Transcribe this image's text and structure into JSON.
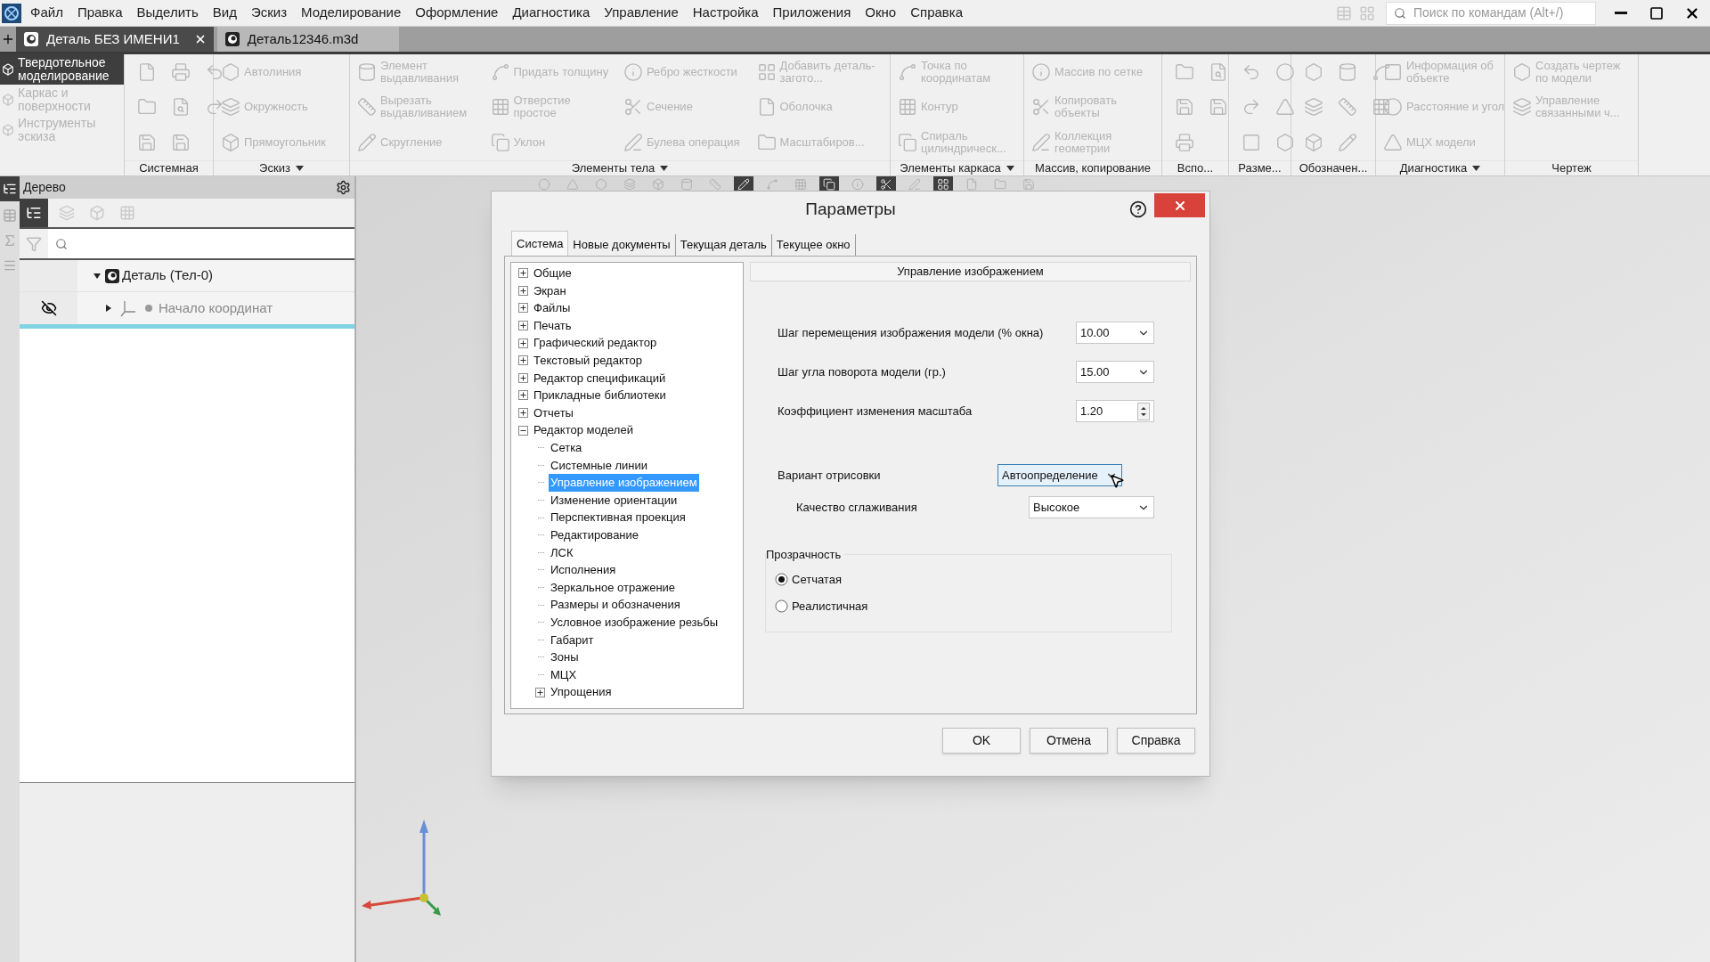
{
  "menu": [
    "Файл",
    "Правка",
    "Выделить",
    "Вид",
    "Эскиз",
    "Моделирование",
    "Оформление",
    "Диагностика",
    "Управление",
    "Настройка",
    "Приложения",
    "Окно",
    "Справка"
  ],
  "command_search": {
    "placeholder": "Поиск по командам (Alt+/)"
  },
  "doc_tabs": [
    {
      "title": "Деталь БЕЗ ИМЕНИ1",
      "selected": true
    },
    {
      "title": "Деталь12346.m3d",
      "selected": false
    }
  ],
  "ribbon": {
    "modes": [
      {
        "label": "Твердотельное моделирование",
        "selected": true
      },
      {
        "label": "Каркас и поверхности",
        "selected": false
      },
      {
        "label": "Инструменты эскиза",
        "selected": false
      }
    ],
    "groups": [
      {
        "label": "Системная",
        "dropdown": false,
        "items": [
          {
            "kind": "icon"
          },
          {
            "kind": "icon"
          },
          {
            "kind": "icon"
          },
          {
            "kind": "icon"
          },
          {
            "kind": "icon"
          },
          {
            "kind": "icon"
          },
          {
            "kind": "icon"
          },
          {
            "kind": "icon"
          }
        ]
      },
      {
        "label": "Эскиз",
        "dropdown": true,
        "items": [
          {
            "kind": "command",
            "label": "Автолиния"
          },
          {
            "kind": "command",
            "label": "Окружность"
          },
          {
            "kind": "command",
            "label": "Прямоугольник"
          }
        ]
      },
      {
        "label": "Элементы тела",
        "dropdown": true,
        "items": [
          {
            "kind": "command",
            "label": "Элемент выдавливания"
          },
          {
            "kind": "command",
            "label": "Вырезать выдавливанием"
          },
          {
            "kind": "command",
            "label": "Скругление"
          },
          {
            "kind": "command",
            "label": "Придать толщину"
          },
          {
            "kind": "command",
            "label": "Отверстие простое"
          },
          {
            "kind": "command",
            "label": "Уклон"
          },
          {
            "kind": "command",
            "label": "Ребро жесткости"
          },
          {
            "kind": "command",
            "label": "Сечение"
          },
          {
            "kind": "command",
            "label": "Булева операция"
          },
          {
            "kind": "command",
            "label": "Добавить деталь-загото..."
          },
          {
            "kind": "command",
            "label": "Оболочка"
          },
          {
            "kind": "command",
            "label": "Масштабиров..."
          }
        ]
      },
      {
        "label": "Элементы каркаса",
        "dropdown": true,
        "items": [
          {
            "kind": "command",
            "label": "Точка по координатам"
          },
          {
            "kind": "command",
            "label": "Контур"
          },
          {
            "kind": "command",
            "label": "Спираль цилиндрическ..."
          }
        ]
      },
      {
        "label": "Массив, копирование",
        "dropdown": false,
        "items": [
          {
            "kind": "command",
            "label": "Массив по сетке"
          },
          {
            "kind": "command",
            "label": "Копировать объекты"
          },
          {
            "kind": "command",
            "label": "Коллекция геометрии"
          }
        ]
      },
      {
        "label": "Вспо...",
        "dropdown": false,
        "items": [
          {
            "kind": "icon"
          },
          {
            "kind": "icon"
          },
          {
            "kind": "icon"
          },
          {
            "kind": "icon"
          },
          {
            "kind": "icon"
          }
        ]
      },
      {
        "label": "Разме...",
        "dropdown": false,
        "items": [
          {
            "kind": "icon"
          },
          {
            "kind": "icon"
          },
          {
            "kind": "icon"
          },
          {
            "kind": "icon"
          },
          {
            "kind": "icon"
          },
          {
            "kind": "icon"
          }
        ]
      },
      {
        "label": "Обозначен...",
        "dropdown": false,
        "items": [
          {
            "kind": "icon"
          },
          {
            "kind": "icon"
          },
          {
            "kind": "icon"
          },
          {
            "kind": "icon"
          },
          {
            "kind": "icon"
          },
          {
            "kind": "icon"
          },
          {
            "kind": "icon"
          },
          {
            "kind": "icon"
          }
        ]
      },
      {
        "label": "Диагностика",
        "dropdown": true,
        "items": [
          {
            "kind": "command",
            "label": "Информация об объекте"
          },
          {
            "kind": "command",
            "label": "Расстояние и угол"
          },
          {
            "kind": "command",
            "label": "МЦХ модели"
          }
        ]
      },
      {
        "label": "Чертеж",
        "dropdown": false,
        "items": [
          {
            "kind": "command",
            "label": "Создать чертеж по модели"
          },
          {
            "kind": "command",
            "label": "Управление связанными ч..."
          }
        ]
      }
    ]
  },
  "tree_panel": {
    "title": "Дерево",
    "nodes": [
      {
        "label": "Деталь (Тел-0)",
        "expanded": true,
        "hidden": false,
        "children": [
          {
            "label": "Начало координат",
            "expanded": false,
            "hidden": true
          }
        ]
      }
    ]
  },
  "dialog": {
    "title": "Параметры",
    "tabs": [
      {
        "label": "Система",
        "selected": true
      },
      {
        "label": "Новые документы",
        "selected": false
      },
      {
        "label": "Текущая деталь",
        "selected": false
      },
      {
        "label": "Текущее окно",
        "selected": false
      }
    ],
    "tree": [
      {
        "label": "Общие",
        "expanded": false,
        "selected": false
      },
      {
        "label": "Экран",
        "expanded": false,
        "selected": false
      },
      {
        "label": "Файлы",
        "expanded": false,
        "selected": false
      },
      {
        "label": "Печать",
        "expanded": false,
        "selected": false
      },
      {
        "label": "Графический редактор",
        "expanded": false,
        "selected": false
      },
      {
        "label": "Текстовый редактор",
        "expanded": false,
        "selected": false
      },
      {
        "label": "Редактор спецификаций",
        "expanded": false,
        "selected": false
      },
      {
        "label": "Прикладные библиотеки",
        "expanded": false,
        "selected": false
      },
      {
        "label": "Отчеты",
        "expanded": false,
        "selected": false
      },
      {
        "label": "Редактор моделей",
        "expanded": true,
        "selected": false,
        "children": [
          {
            "label": "Сетка",
            "selected": false
          },
          {
            "label": "Системные линии",
            "selected": false
          },
          {
            "label": "Управление изображением",
            "selected": true
          },
          {
            "label": "Изменение ориентации",
            "selected": false
          },
          {
            "label": "Перспективная проекция",
            "selected": false
          },
          {
            "label": "Редактирование",
            "selected": false
          },
          {
            "label": "ЛСК",
            "selected": false
          },
          {
            "label": "Исполнения",
            "selected": false
          },
          {
            "label": "Зеркальное отражение",
            "selected": false
          },
          {
            "label": "Размеры и обозначения",
            "selected": false
          },
          {
            "label": "Условное изображение резьбы",
            "selected": false
          },
          {
            "label": "Габарит",
            "selected": false
          },
          {
            "label": "Зоны",
            "selected": false
          },
          {
            "label": "МЦХ",
            "selected": false
          },
          {
            "label": "Упрощения",
            "expanded": false,
            "selected": false
          }
        ]
      }
    ],
    "section_title": "Управление изображением",
    "fields": [
      {
        "kind": "dropdown",
        "label": "Шаг перемещения изображения модели (% окна)",
        "value": "10.00",
        "focused": false
      },
      {
        "kind": "dropdown",
        "label": "Шаг угла поворота модели (гр.)",
        "value": "15.00",
        "focused": false
      },
      {
        "kind": "spinner",
        "label": "Коэффициент изменения масштаба",
        "value": "1.20",
        "focused": false
      }
    ],
    "render_fields": [
      {
        "kind": "dropdown",
        "label": "Вариант отрисовки",
        "value": "Автоопределение",
        "focused": true,
        "children": [
          {
            "kind": "dropdown",
            "label": "Качество сглаживания",
            "value": "Высокое",
            "focused": false
          }
        ]
      }
    ],
    "transparency": {
      "label": "Прозрачность",
      "options": [
        {
          "label": "Сетчатая",
          "selected": true
        },
        {
          "label": "Реалистичная",
          "selected": false
        }
      ]
    },
    "buttons": [
      "OK",
      "Отмена",
      "Справка"
    ]
  }
}
